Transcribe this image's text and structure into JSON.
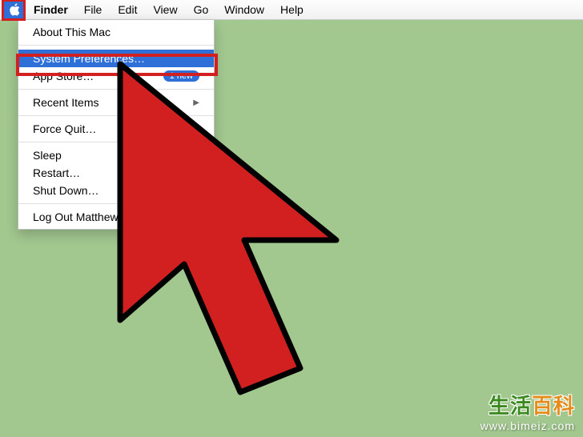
{
  "menubar": {
    "app": "Finder",
    "items": [
      "File",
      "Edit",
      "View",
      "Go",
      "Window",
      "Help"
    ]
  },
  "dropdown": {
    "about": "About This Mac",
    "syspref": "System Preferences…",
    "appstore": "App Store…",
    "appstore_badge": "1 new",
    "recent": "Recent Items",
    "forcequit": "Force Quit…",
    "sleep": "Sleep",
    "restart": "Restart…",
    "shutdown": "Shut Down…",
    "logout": "Log Out Matthew…"
  },
  "watermark": {
    "cn1": "生活",
    "cn2": "百科",
    "url": "www.bimeiz.com"
  }
}
